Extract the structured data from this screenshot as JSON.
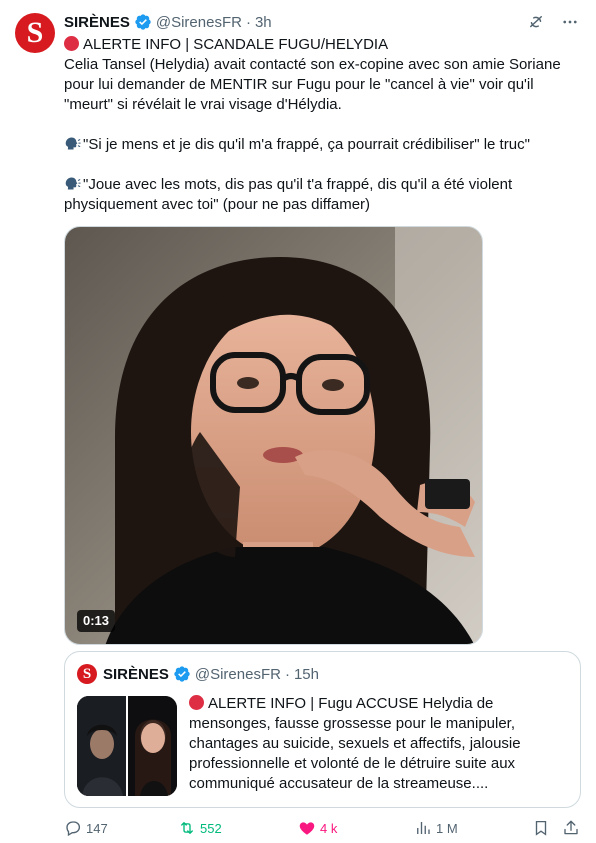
{
  "author": {
    "name": "SIRÈNES",
    "handle": "@SirenesFR",
    "separator": "·",
    "time": "3h",
    "avatar_letter": "S"
  },
  "header_icons": [
    "grok-icon",
    "more-icon"
  ],
  "tweet": {
    "line1": "ALERTE INFO | SCANDALE FUGU/HELYDIA",
    "para1": "Celia Tansel (Helydia) avait contacté son ex-copine avec son amie Soriane pour lui demander de MENTIR sur Fugu pour le \"cancel à vie\" voir qu'il \"meurt\" si révélait le vrai visage d'Hélydia.",
    "quote1": "\"Si je mens et je dis qu'il m'a frappé, ça pourrait crédibiliser\" le truc\"",
    "quote2": "\"Joue avec les mots, dis pas qu'il t'a frappé, dis qu'il a été violent physiquement avec toi\" (pour ne pas diffamer)"
  },
  "media": {
    "duration": "0:13"
  },
  "quoted_tweet": {
    "name": "SIRÈNES",
    "handle": "@SirenesFR",
    "separator": "·",
    "time": "15h",
    "avatar_letter": "S",
    "text": "ALERTE INFO | Fugu ACCUSE Helydia de mensonges, fausse grossesse pour le manipuler, chantages au suicide, sexuels et  affectifs, jalousie professionnelle et volonté de le détruire suite aux communiqué accusateur de la streameuse...."
  },
  "actions": {
    "replies": "147",
    "reposts": "552",
    "likes": "4 k",
    "views": "1 M"
  },
  "colors": {
    "brand_red": "#d61a1f",
    "verified_blue": "#1d9bf0",
    "repost_green": "#00ba7c",
    "like_pink": "#f91880",
    "secondary_text": "#536471"
  }
}
